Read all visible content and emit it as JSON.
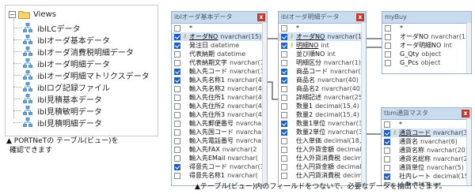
{
  "tree": {
    "root_label": "Views",
    "items": [
      "iblLCデータ",
      "iblオーダ基本データ",
      "iblオーダ消費税明細データ",
      "iblオーダ明細データ",
      "iblオーダ明細マトリクスデータ",
      "iblログ記録ファイル",
      "ibl見積基本データ",
      "ibl見積敏明データ",
      "ibl見積明細データ"
    ]
  },
  "caption_left": [
    "▲ PORTNeTの テーブル(ビュー)を",
    "確認できます"
  ],
  "caption_right": "▲テーブル(ビュー)内のフィールドをつないで、必要なデータを抽出できます。",
  "windows": {
    "order_basic": {
      "title": "iblオーダ基本データ",
      "fields": [
        {
          "name": "*",
          "type": "",
          "checked": false,
          "key": false
        },
        {
          "name": "オーダNO",
          "type": "nvarchar(15)",
          "checked": true,
          "key": true
        },
        {
          "name": "発注日",
          "type": "datetime",
          "checked": true,
          "key": false
        },
        {
          "name": "代表納期",
          "type": "datetime",
          "checked": false,
          "key": false
        },
        {
          "name": "代表納期文字",
          "type": "nvarchar(1",
          "checked": false,
          "key": false
        },
        {
          "name": "輸入先コード",
          "type": "nvarchar(1",
          "checked": true,
          "key": false
        },
        {
          "name": "輸入先名称1",
          "type": "nvarchar(4",
          "checked": true,
          "key": false
        },
        {
          "name": "輸入先名称2",
          "type": "nvarchar(4",
          "checked": false,
          "key": false
        },
        {
          "name": "輸入先住所1",
          "type": "nvarchar(4",
          "checked": false,
          "key": false
        },
        {
          "name": "輸入先住所2",
          "type": "nvarchar(4",
          "checked": false,
          "key": false
        },
        {
          "name": "輸入先住所3",
          "type": "nvarchar(4",
          "checked": false,
          "key": false
        },
        {
          "name": "輸入先郵便番号",
          "type": "nvarchar",
          "checked": false,
          "key": false
        },
        {
          "name": "輸入先国コード",
          "type": "nvarchar(",
          "checked": false,
          "key": false
        },
        {
          "name": "輸入先電話番号",
          "type": "nvarchar",
          "checked": false,
          "key": false
        },
        {
          "name": "輸入先FAX",
          "type": "nvarchar(2",
          "checked": false,
          "key": false
        },
        {
          "name": "輸入先EMail",
          "type": "nvarchar(",
          "checked": false,
          "key": false
        },
        {
          "name": "得意先コード",
          "type": "nvarchar(1",
          "checked": true,
          "key": false
        },
        {
          "name": "得意先名称1",
          "type": "nvarchar(",
          "checked": false,
          "key": false
        }
      ]
    },
    "order_detail": {
      "title": "iblオーダ明細データ",
      "fields": [
        {
          "name": "*",
          "type": "",
          "checked": false,
          "key": false
        },
        {
          "name": "オーダNO",
          "type": "nvarchar(15)",
          "checked": true,
          "key": true
        },
        {
          "name": "明細NO",
          "type": "int",
          "checked": true,
          "key": true
        },
        {
          "name": "並び順NO",
          "type": "int",
          "checked": false,
          "key": false
        },
        {
          "name": "明細区分",
          "type": "nvarchar(1)",
          "checked": false,
          "key": false
        },
        {
          "name": "商品コード",
          "type": "nvarchar(20)",
          "checked": true,
          "key": false
        },
        {
          "name": "商品名",
          "type": "nvarchar(40)",
          "checked": true,
          "key": false
        },
        {
          "name": "商品名2",
          "type": "nvarchar(40)",
          "checked": false,
          "key": false
        },
        {
          "name": "詳細記述",
          "type": "nvarchar(255)",
          "checked": false,
          "key": false
        },
        {
          "name": "数量1",
          "type": "decimal(15,4)",
          "checked": false,
          "key": false
        },
        {
          "name": "数量2",
          "type": "decimal(15,4)",
          "checked": false,
          "key": false
        },
        {
          "name": "数量1単位",
          "type": "nvarchar(3)",
          "checked": true,
          "key": false
        },
        {
          "name": "数量2単位",
          "type": "nvarchar(3)",
          "checked": true,
          "key": false
        },
        {
          "name": "仕入単価",
          "type": "decimal(18,6)",
          "checked": false,
          "key": false
        },
        {
          "name": "仕入外貨金額",
          "type": "decimal(",
          "checked": false,
          "key": false
        },
        {
          "name": "仕入外貨消費税",
          "type": "decimal",
          "checked": false,
          "key": false
        },
        {
          "name": "仕入円貨金額",
          "type": "decimal(",
          "checked": false,
          "key": false
        },
        {
          "name": "仕入円貨消費税",
          "type": "decimal",
          "checked": false,
          "key": false
        }
      ]
    },
    "mybuy": {
      "title": "myBuy",
      "fields": [
        {
          "name": "*",
          "type": "",
          "checked": false,
          "key": false
        },
        {
          "name": "オーダNO",
          "type": "nvarchar(15)",
          "checked": false,
          "key": false
        },
        {
          "name": "オーダ明細NO",
          "type": "int",
          "checked": false,
          "key": false
        },
        {
          "name": "G_Qty",
          "type": "object",
          "checked": false,
          "key": false
        },
        {
          "name": "G_Pcs",
          "type": "object",
          "checked": false,
          "key": false
        }
      ]
    },
    "currency": {
      "title": "tbm通貨マスタ",
      "fields": [
        {
          "name": "*",
          "type": "",
          "checked": false,
          "key": false
        },
        {
          "name": "通貨コード",
          "type": "nvarchar(3)",
          "checked": true,
          "key": true
        },
        {
          "name": "通貨名",
          "type": "nvarchar(6)",
          "checked": true,
          "key": false
        },
        {
          "name": "通貨名称",
          "type": "nvarchar(20)",
          "checked": false,
          "key": false
        },
        {
          "name": "通貨名総称",
          "type": "nvarchar(20)",
          "checked": false,
          "key": false
        },
        {
          "name": "通貨単位",
          "type": "nvarchar(5)",
          "checked": false,
          "key": false
        },
        {
          "name": "社内レート",
          "type": "decimal(15,4)",
          "checked": true,
          "key": false
        },
        {
          "name": "小数点以下",
          "type": "int",
          "checked": false,
          "key": false
        }
      ]
    }
  },
  "colors": {
    "title_bar": "#c9dbee",
    "checked": "#1f5fbf",
    "close": "#c0392b",
    "key": "#c99a06"
  }
}
